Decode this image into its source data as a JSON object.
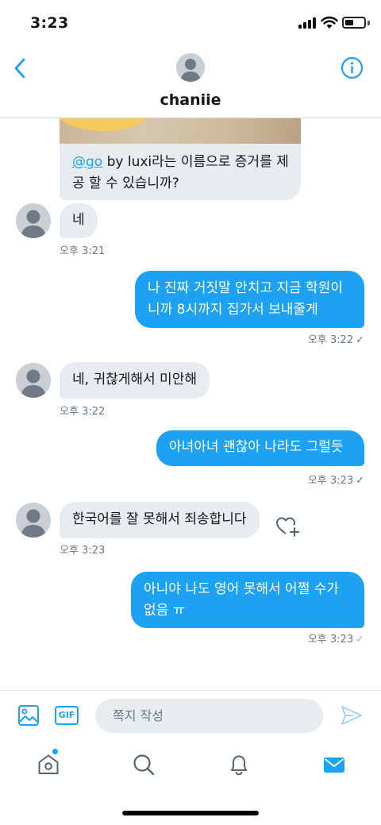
{
  "status_bar": {
    "time": "3:23"
  },
  "header": {
    "name": "chaniie",
    "back_icon": "chevron-left-icon",
    "info_icon": "info-icon"
  },
  "messages": [
    {
      "side": "in",
      "type": "media",
      "mention": "@go",
      "text_rest": " by luxi라는 이름으로 증거를 제공 할 수 있습니까?"
    },
    {
      "side": "in",
      "text": "네",
      "time": "오후 3:21"
    },
    {
      "side": "out",
      "text": "나 진짜 거짓말 안치고 지금 학원이니까 8시까지 집가서 보내줄게",
      "time": "오후 3:22",
      "read": true
    },
    {
      "side": "in",
      "text": "네, 귀찮게해서 미안해",
      "time": "오후 3:22"
    },
    {
      "side": "out",
      "text": "아녀아녀 괜찮아 나라도 그럴듯",
      "time": "오후 3:23",
      "read": true
    },
    {
      "side": "in",
      "text": "한국어를 잘 못해서 죄송합니다",
      "time": "오후 3:23"
    },
    {
      "side": "out",
      "text": "아니야 나도 영어 못해서 어쩔 수가 없음 ㅠ",
      "time": "오후 3:23",
      "read": false
    }
  ],
  "composer": {
    "placeholder": "쪽지 작성",
    "gif_label": "GIF"
  },
  "tabs": [
    {
      "name": "home",
      "icon": "home-icon",
      "has_dot": true
    },
    {
      "name": "search",
      "icon": "search-icon"
    },
    {
      "name": "notifications",
      "icon": "bell-icon"
    },
    {
      "name": "messages",
      "icon": "mail-icon",
      "active": true
    }
  ],
  "colors": {
    "accent": "#1da1f2",
    "bubble_in": "#e6ecf0",
    "timestamp": "#657786"
  }
}
